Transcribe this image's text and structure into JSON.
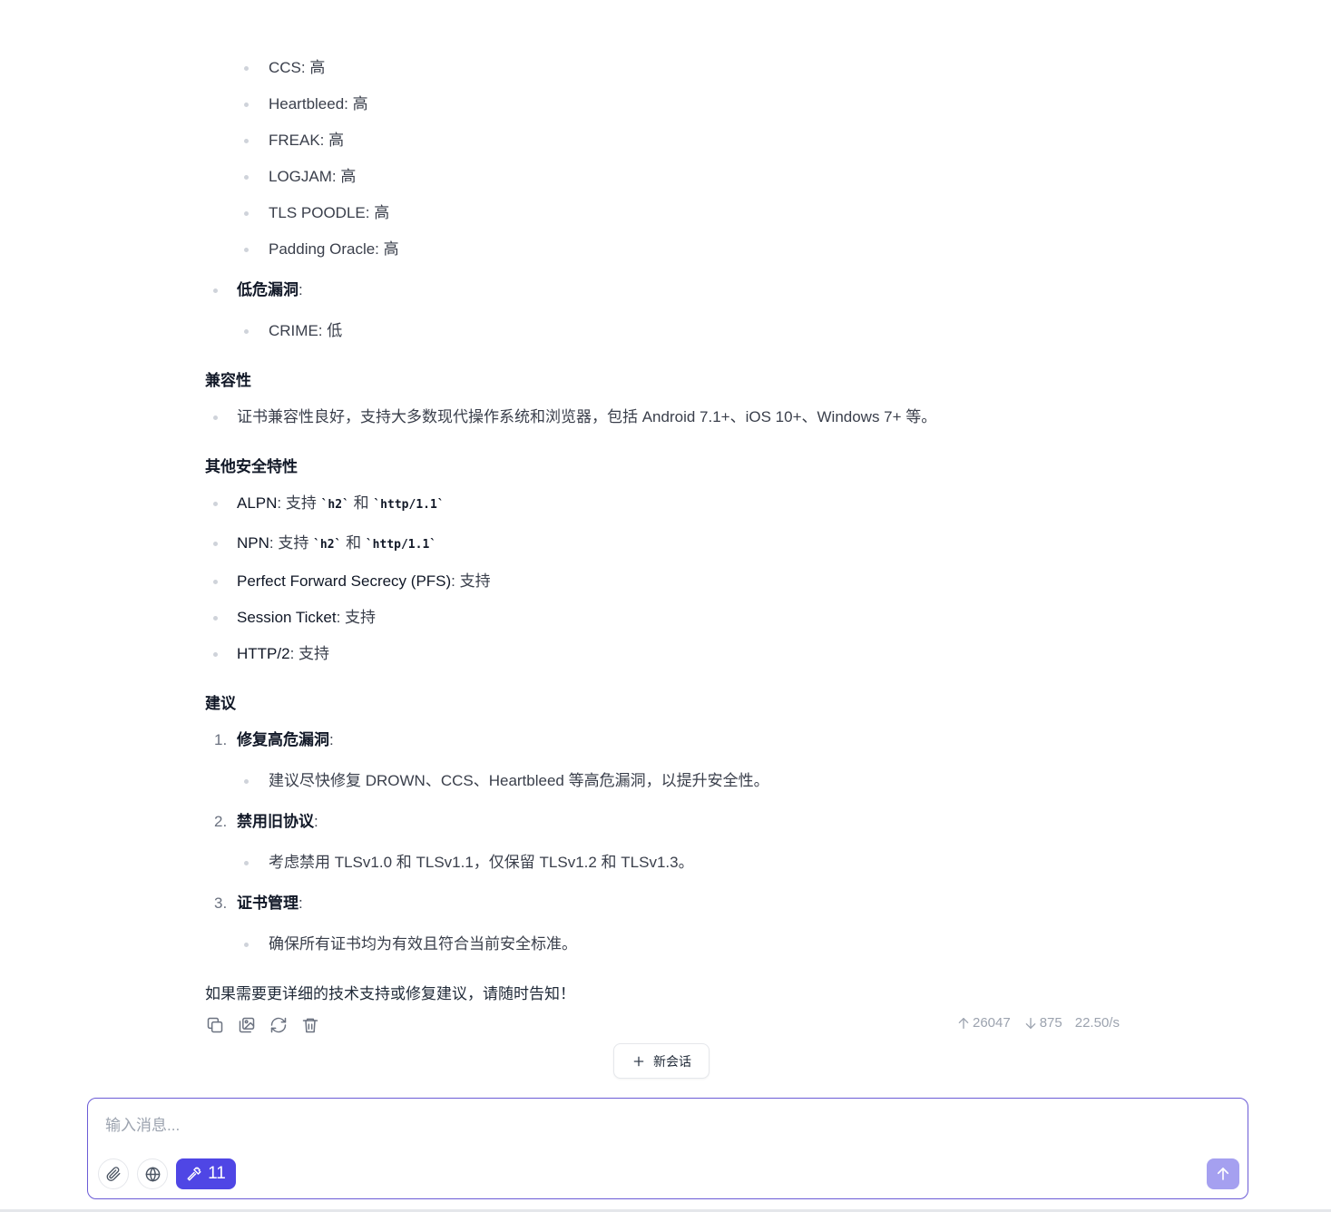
{
  "message": {
    "high_vuln_items": [
      "CCS: 高",
      "Heartbleed: 高",
      "FREAK: 高",
      "LOGJAM: 高",
      "TLS POODLE: 高",
      "Padding Oracle: 高"
    ],
    "low_vuln": {
      "label": "低危漏洞",
      "suffix": ":",
      "items": [
        "CRIME: 低"
      ]
    },
    "compatibility": {
      "heading": "兼容性",
      "items": [
        "证书兼容性良好，支持大多数现代操作系统和浏览器，包括 Android 7.1+、iOS 10+、Windows 7+ 等。"
      ]
    },
    "other_security": {
      "heading": "其他安全特性",
      "alpn": {
        "key": "ALPN",
        "text1": ": 支持 ",
        "code1": "`h2`",
        "text2": " 和 ",
        "code2": "`http/1.1`"
      },
      "npn": {
        "key": "NPN",
        "text1": ": 支持 ",
        "code1": "`h2`",
        "text2": " 和 ",
        "code2": "`http/1.1`"
      },
      "items": [
        {
          "key": "Perfect Forward Secrecy (PFS)",
          "value": ": 支持"
        },
        {
          "key": "Session Ticket",
          "value": ": 支持"
        },
        {
          "key": "HTTP/2",
          "value": ": 支持"
        }
      ]
    },
    "recommendations": {
      "heading": "建议",
      "items": [
        {
          "number": "1.",
          "title": "修复高危漏洞",
          "suffix": ":",
          "detail": "建议尽快修复 DROWN、CCS、Heartbleed 等高危漏洞，以提升安全性。"
        },
        {
          "number": "2.",
          "title": "禁用旧协议",
          "suffix": ":",
          "detail": "考虑禁用 TLSv1.0 和 TLSv1.1，仅保留 TLSv1.2 和 TLSv1.3。"
        },
        {
          "number": "3.",
          "title": "证书管理",
          "suffix": ":",
          "detail": "确保所有证书均为有效且符合当前安全标准。"
        }
      ]
    },
    "closing": "如果需要更详细的技术支持或修复建议，请随时告知！"
  },
  "actions": {
    "icons": [
      "copy-icon",
      "image-icon",
      "refresh-icon",
      "trash-icon"
    ]
  },
  "stats": {
    "tokens_up": "26047",
    "tokens_down": "875",
    "speed": "22.50/s"
  },
  "new_chat_label": "新会话",
  "composer": {
    "placeholder": "输入消息...",
    "tools_count": "11",
    "accent_color": "#4f46e5",
    "send_color": "#a5a0f0"
  }
}
